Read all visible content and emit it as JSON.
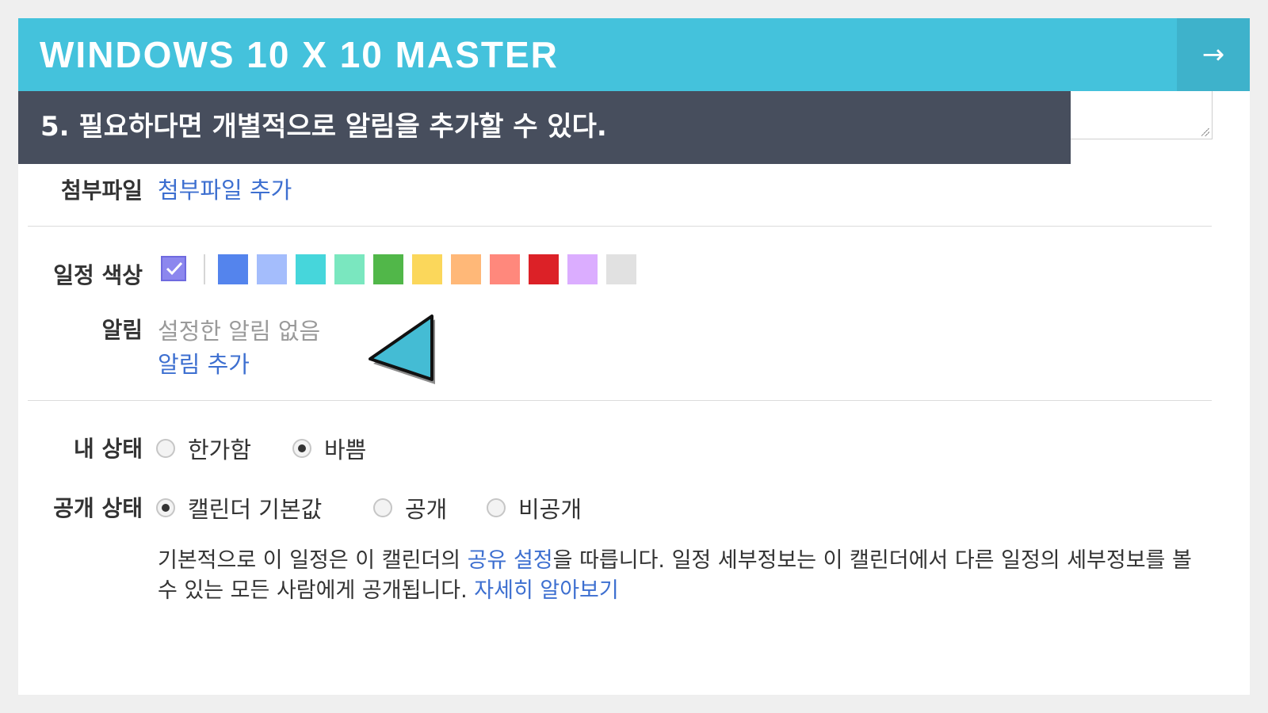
{
  "banner": {
    "title": "WINDOWS 10 X 10 MASTER",
    "next_icon": "arrow-right-icon",
    "next_glyph": "→",
    "background_color": "#44c2dc"
  },
  "step": {
    "text": "5. 필요하다면 개별적으로 알림을 추가할 수 있다.",
    "background_color": "#474e5d"
  },
  "attachment": {
    "label": "첨부파일",
    "add_link": "첨부파일 추가"
  },
  "event_color": {
    "label": "일정 색상",
    "current": "#8c87ee",
    "swatches": [
      "#5484ed",
      "#a4bdfc",
      "#46d6db",
      "#7ae7bf",
      "#51b749",
      "#fbd75b",
      "#ffb878",
      "#ff887c",
      "#dc2127",
      "#dbadff",
      "#e1e1e1"
    ]
  },
  "alarm": {
    "label": "알림",
    "none_text": "설정한 알림 없음",
    "add_link": "알림 추가"
  },
  "my_status": {
    "label": "내 상태",
    "options": [
      {
        "label": "한가함",
        "checked": false
      },
      {
        "label": "바쁨",
        "checked": true
      }
    ]
  },
  "visibility": {
    "label": "공개 상태",
    "options": [
      {
        "label": "캘린더 기본값",
        "checked": true
      },
      {
        "label": "공개",
        "checked": false
      },
      {
        "label": "비공개",
        "checked": false
      }
    ]
  },
  "description": {
    "part1": "기본적으로 이 일정은 이 캘린더의 ",
    "link1": "공유 설정",
    "part2": "을 따릅니다. 일정 세부정보는 이 캘린더에서 다른 일정의 세부정보를 볼 수 있는 모든 사람에게 공개됩니다. ",
    "link2": "자세히 알아보기"
  },
  "link_color": "#3d6fd0",
  "pointer_color": "#44bcd4"
}
